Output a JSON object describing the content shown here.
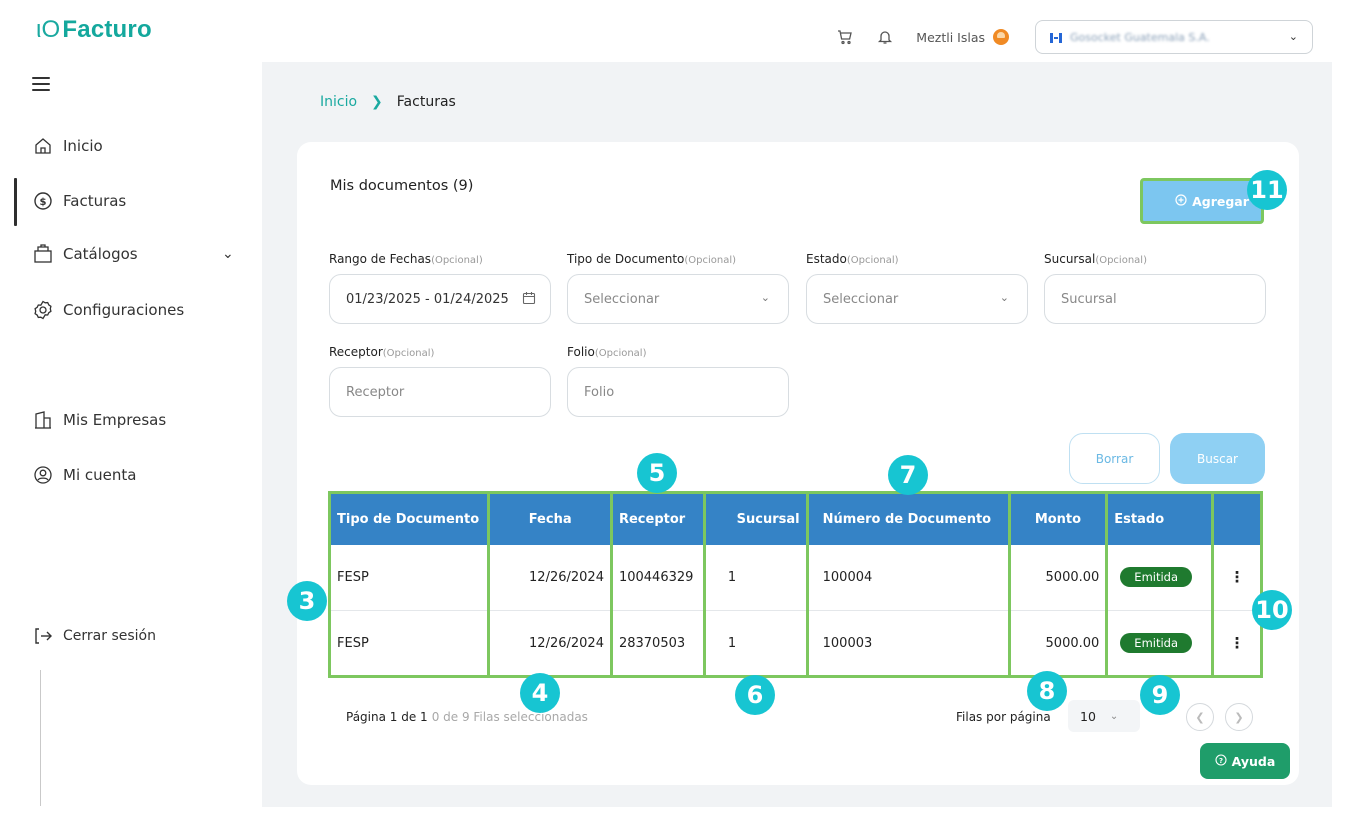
{
  "app": {
    "logo_prefix": "ιO",
    "logo_name": "Facturo"
  },
  "header": {
    "user_name": "Meztli Islas",
    "company": "Gosocket Guatemala S.A."
  },
  "sidebar": {
    "items": [
      {
        "label": "Inicio",
        "icon": "home-icon"
      },
      {
        "label": "Facturas",
        "icon": "dollar-circle-icon"
      },
      {
        "label": "Catálogos",
        "icon": "catalog-icon"
      },
      {
        "label": "Configuraciones",
        "icon": "gear-icon"
      },
      {
        "label": "Mis Empresas",
        "icon": "building-icon"
      },
      {
        "label": "Mi cuenta",
        "icon": "user-circle-icon"
      }
    ],
    "logout": "Cerrar sesión"
  },
  "breadcrumb": {
    "home": "Inicio",
    "current": "Facturas"
  },
  "page": {
    "title": "Mis documentos (9)",
    "add_label": "Agregar"
  },
  "filters": {
    "optional": "(Opcional)",
    "date_range": {
      "label": "Rango de Fechas",
      "value": "01/23/2025 - 01/24/2025"
    },
    "doc_type": {
      "label": "Tipo de Documento",
      "placeholder": "Seleccionar"
    },
    "status": {
      "label": "Estado",
      "placeholder": "Seleccionar"
    },
    "branch": {
      "label": "Sucursal",
      "placeholder": "Sucursal"
    },
    "receiver": {
      "label": "Receptor",
      "placeholder": "Receptor"
    },
    "folio": {
      "label": "Folio",
      "placeholder": "Folio"
    },
    "clear_label": "Borrar",
    "search_label": "Buscar"
  },
  "table": {
    "headers": [
      "Tipo de Documento",
      "Fecha",
      "Receptor",
      "Sucursal",
      "Número de Documento",
      "Monto",
      "Estado",
      ""
    ],
    "rows": [
      {
        "type": "FESP",
        "date": "12/26/2024",
        "receiver": "100446329",
        "branch": "1",
        "number": "100004",
        "amount": "5000.00",
        "status": "Emitida"
      },
      {
        "type": "FESP",
        "date": "12/26/2024",
        "receiver": "28370503",
        "branch": "1",
        "number": "100003",
        "amount": "5000.00",
        "status": "Emitida"
      }
    ]
  },
  "pagination": {
    "page_info": "Página 1 de 1",
    "selected_info": "0 de 9 Filas seleccionadas",
    "rows_per_page_label": "Filas por página",
    "rows_per_page": "10"
  },
  "help_label": "Ayuda",
  "markers": [
    "3",
    "4",
    "5",
    "6",
    "7",
    "8",
    "9",
    "10",
    "11"
  ],
  "colors": {
    "brand": "#1aa9a0",
    "table_header": "#3583c6",
    "highlight": "#7dc75f",
    "badge": "#1f7a2f",
    "marker": "#17c5d2"
  }
}
